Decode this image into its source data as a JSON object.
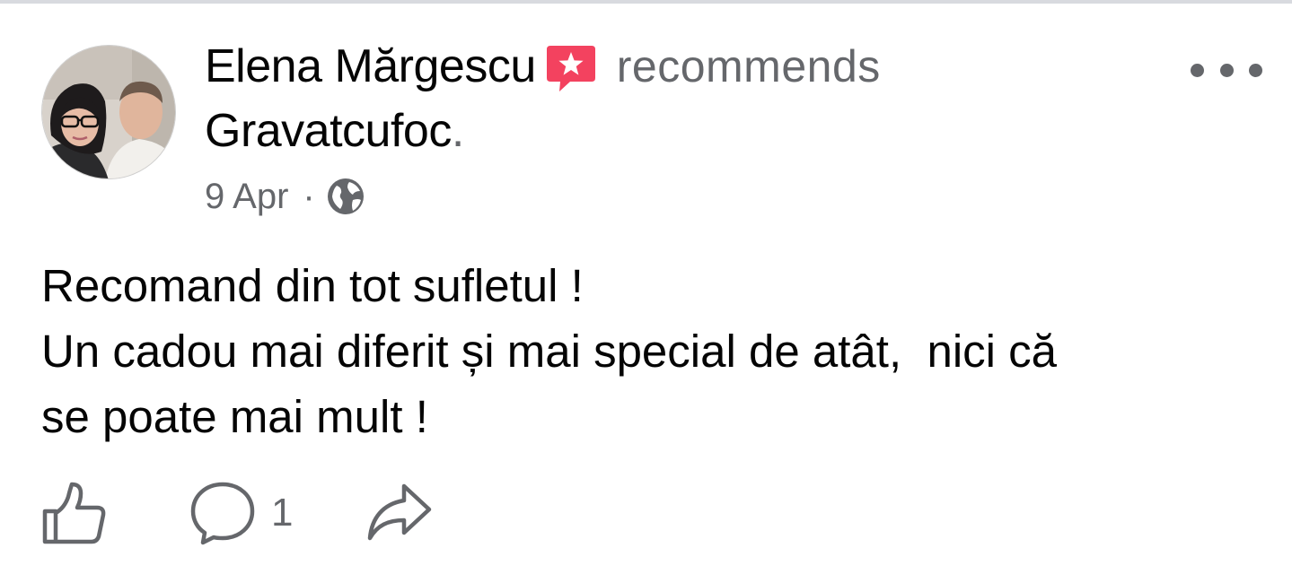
{
  "post": {
    "author_name": "Elena Mărgescu",
    "action_text": "recommends",
    "page_name": "Gravatcufoc",
    "page_suffix": ".",
    "date": "9 Apr",
    "meta_separator": "·",
    "privacy_icon": "globe-icon",
    "body_lines": [
      "Recomand din tot sufletul !",
      "Un cadou mai diferit și mai special de atât,  nici că",
      "se poate mai mult !"
    ]
  },
  "actions": {
    "like_icon": "thumbs-up-icon",
    "comment_icon": "comment-icon",
    "comment_count": "1",
    "share_icon": "share-arrow-icon"
  },
  "colors": {
    "recommendation_badge": "#f3425f",
    "secondary_text": "#65676b",
    "primary_text": "#050505"
  }
}
